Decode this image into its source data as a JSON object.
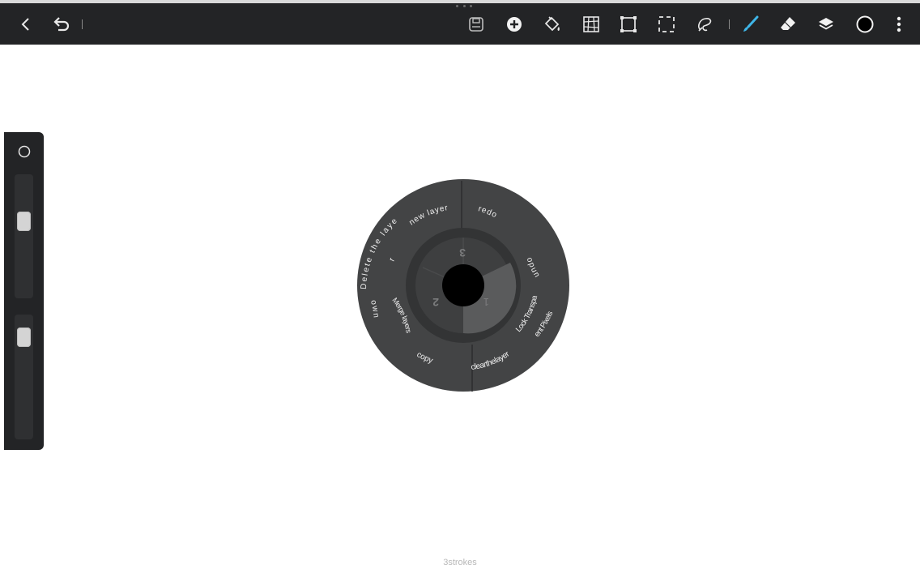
{
  "toolbar": {
    "left_buttons": [
      "back",
      "undo"
    ],
    "right_buttons": [
      "save",
      "add",
      "fill",
      "grid",
      "transform",
      "selection",
      "lasso",
      "brush",
      "eraser",
      "layers",
      "color",
      "more"
    ],
    "accent_color": "#3fb6e8"
  },
  "side_panel": {
    "size_slider_level": 0.35,
    "opacity_slider_level": 0.1
  },
  "radial_menu": {
    "outer_items": [
      {
        "label": "redo"
      },
      {
        "label": "undo"
      },
      {
        "label_line1": "Lock Transpar",
        "label_line2": "ent Pixels"
      },
      {
        "label": "clearthelayer"
      },
      {
        "label": "copy"
      },
      {
        "label": "own"
      },
      {
        "label": "Merge layers dr"
      },
      {
        "label_line1": "Delete the laye",
        "label_line2": "r"
      },
      {
        "label": "new layer"
      }
    ],
    "inner_numbers": [
      "1",
      "2",
      "3"
    ]
  },
  "footer": {
    "status": "3strokes"
  }
}
